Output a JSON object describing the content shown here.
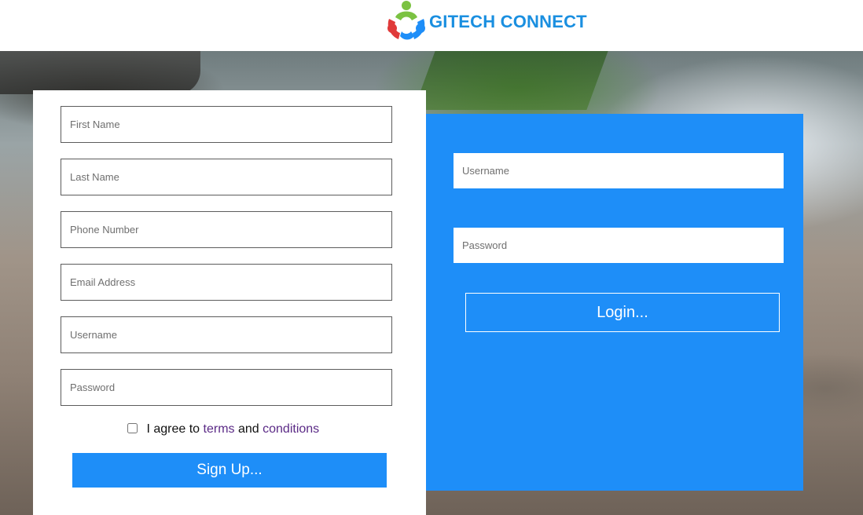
{
  "brand": {
    "name": "GITECH CONNECT",
    "text_color": "#1a8fe0",
    "logo_icon": "people-circle-logo-icon",
    "logo_colors": [
      "#7bc242",
      "#e03a3a",
      "#1e8ef8"
    ]
  },
  "colors": {
    "accent": "#1e8ef8",
    "link": "#5b2a86"
  },
  "signup": {
    "first_name_placeholder": "First Name",
    "last_name_placeholder": "Last Name",
    "phone_placeholder": "Phone Number",
    "email_placeholder": "Email Address",
    "username_placeholder": "Username",
    "password_placeholder": "Password",
    "agree_prefix": "I agree to",
    "terms_link": "terms",
    "and_text": "and",
    "conditions_link": "conditions",
    "agree_checked": false,
    "submit_label": "Sign Up..."
  },
  "login": {
    "username_placeholder": "Username",
    "password_placeholder": "Password",
    "submit_label": "Login..."
  }
}
